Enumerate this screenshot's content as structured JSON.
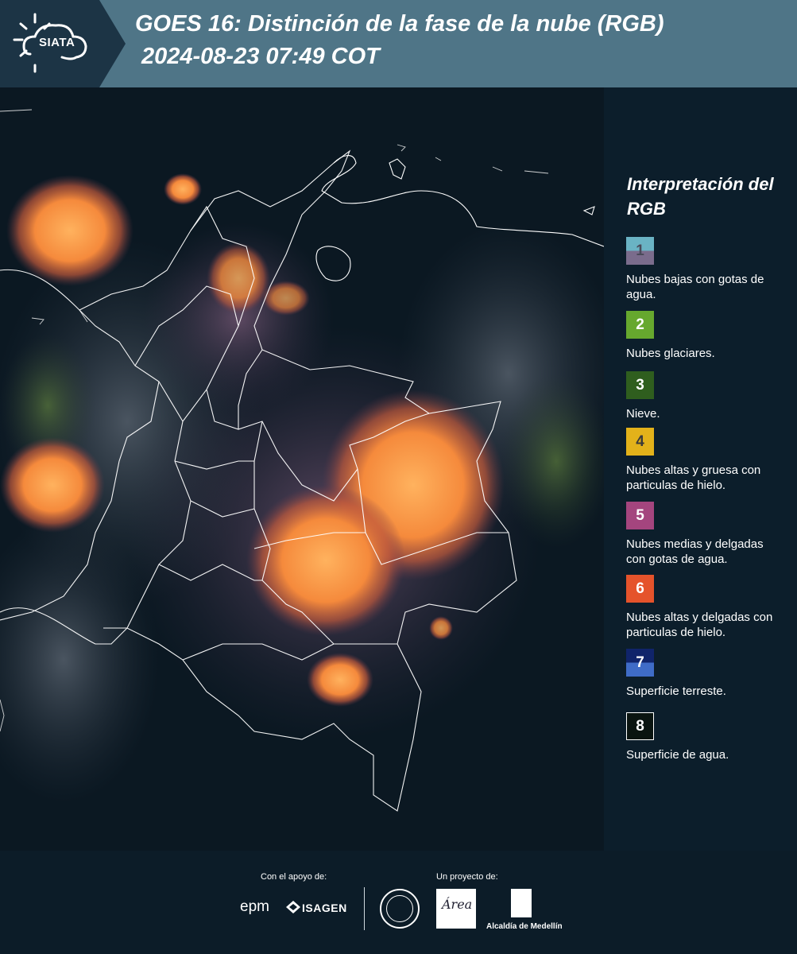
{
  "header": {
    "logo_text": "SIATA",
    "title_line1": "GOES 16: Distinción de la fase de la nube (RGB)",
    "title_line2": "2024-08-23 07:49 COT"
  },
  "legend": {
    "title": "Interpretación del RGB",
    "items": [
      {
        "number": "1",
        "label": "Nubes bajas con gotas de agua.",
        "color_top": "#6ab3c4",
        "color_bottom": "#7a6c8c",
        "text_color": "#4a4a5a"
      },
      {
        "number": "2",
        "label": "Nubes glaciares.",
        "color_top": "#66a82e",
        "color_bottom": "#66a82e",
        "text_color": "#ffffff"
      },
      {
        "number": "3",
        "label": "Nieve.",
        "color_top": "#2f5e1e",
        "color_bottom": "#2f5e1e",
        "text_color": "#ffffff"
      },
      {
        "number": "4",
        "label": "Nubes altas y gruesa con particulas de hielo.",
        "color_top": "#e3b21a",
        "color_bottom": "#e3b21a",
        "text_color": "#3a3a3a"
      },
      {
        "number": "5",
        "label": "Nubes medias y delgadas con gotas de agua.",
        "color_top": "#a4457e",
        "color_bottom": "#a4457e",
        "text_color": "#ffffff"
      },
      {
        "number": "6",
        "label": "Nubes altas y delgadas con particulas de hielo.",
        "color_top": "#e5532b",
        "color_bottom": "#e5532b",
        "text_color": "#ffffff"
      },
      {
        "number": "7",
        "label": "Superficie terreste.",
        "color_top": "#10246a",
        "color_bottom": "#3f6cc7",
        "text_color": "#ffffff"
      },
      {
        "number": "8",
        "label": "Superficie de agua.",
        "color_top": "#0a1410",
        "color_bottom": "#0a1410",
        "text_color": "#ffffff"
      }
    ]
  },
  "footer": {
    "support_label": "Con el apoyo de:",
    "project_label": "Un proyecto de:",
    "sponsor1": "epm",
    "sponsor2": "ISAGEN",
    "partner_area": "Área",
    "partner_alcaldia": "Alcaldía de Medellín"
  },
  "colors": {
    "header_bg": "#4f7587",
    "header_dark": "#1c3445",
    "map_bg": "#0b1822",
    "cloud_orange": "#f58a3c",
    "border_line": "#ffffff"
  }
}
